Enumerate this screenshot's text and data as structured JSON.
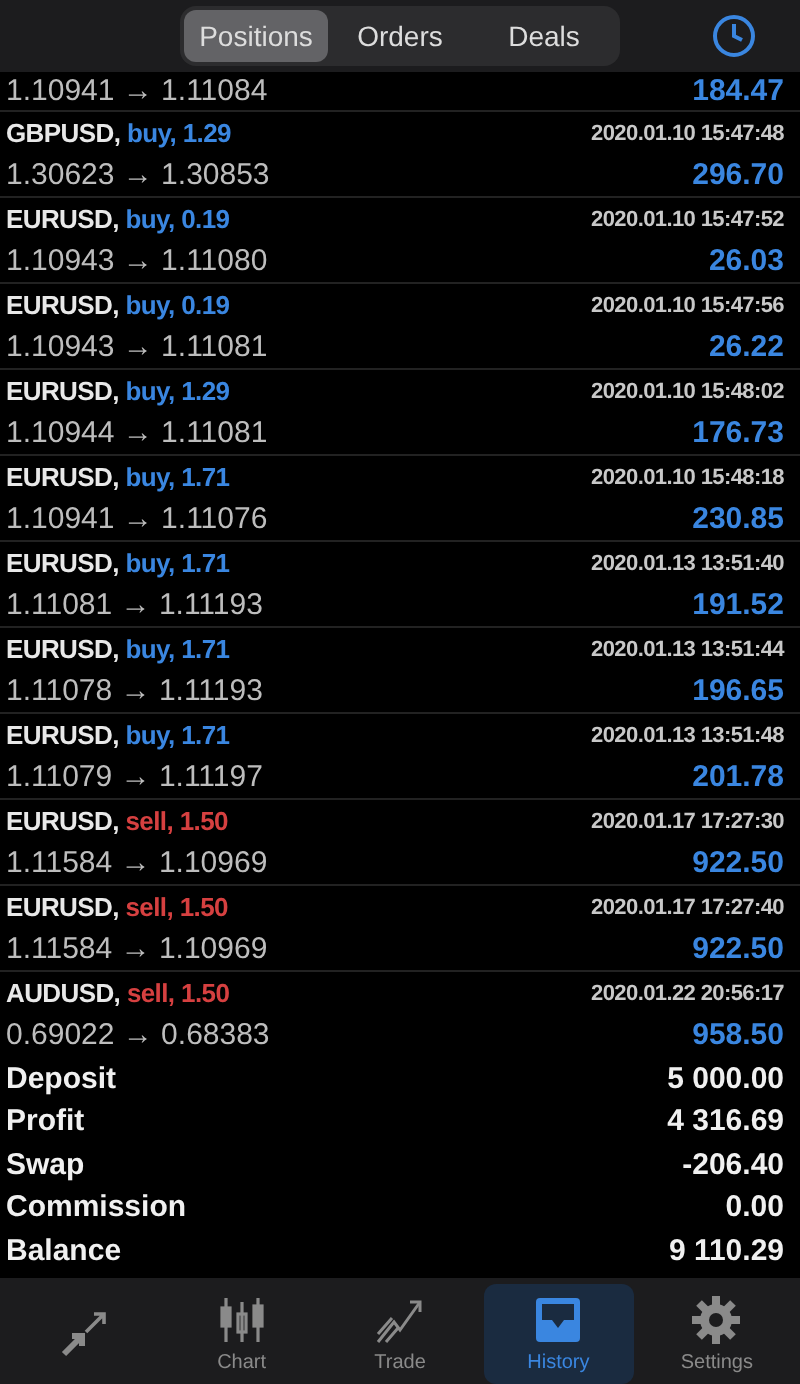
{
  "segments": [
    {
      "label": "Positions",
      "selected": true
    },
    {
      "label": "Orders",
      "selected": false
    },
    {
      "label": "Deals",
      "selected": false
    }
  ],
  "deals": [
    {
      "prices": "1.10941 → 1.11084",
      "profit": "184.47"
    },
    {
      "symbol": "GBPUSD,",
      "kind": "buy",
      "order": "buy, 1.29",
      "time": "2020.01.10 15:47:48",
      "prices": "1.30623 → 1.30853",
      "profit": "296.70"
    },
    {
      "symbol": "EURUSD,",
      "kind": "buy",
      "order": "buy, 0.19",
      "time": "2020.01.10 15:47:52",
      "prices": "1.10943 → 1.11080",
      "profit": "26.03"
    },
    {
      "symbol": "EURUSD,",
      "kind": "buy",
      "order": "buy, 0.19",
      "time": "2020.01.10 15:47:56",
      "prices": "1.10943 → 1.11081",
      "profit": "26.22"
    },
    {
      "symbol": "EURUSD,",
      "kind": "buy",
      "order": "buy, 1.29",
      "time": "2020.01.10 15:48:02",
      "prices": "1.10944 → 1.11081",
      "profit": "176.73"
    },
    {
      "symbol": "EURUSD,",
      "kind": "buy",
      "order": "buy, 1.71",
      "time": "2020.01.10 15:48:18",
      "prices": "1.10941 → 1.11076",
      "profit": "230.85"
    },
    {
      "symbol": "EURUSD,",
      "kind": "buy",
      "order": "buy, 1.71",
      "time": "2020.01.13 13:51:40",
      "prices": "1.11081 → 1.11193",
      "profit": "191.52"
    },
    {
      "symbol": "EURUSD,",
      "kind": "buy",
      "order": "buy, 1.71",
      "time": "2020.01.13 13:51:44",
      "prices": "1.11078 → 1.11193",
      "profit": "196.65"
    },
    {
      "symbol": "EURUSD,",
      "kind": "buy",
      "order": "buy, 1.71",
      "time": "2020.01.13 13:51:48",
      "prices": "1.11079 → 1.11197",
      "profit": "201.78"
    },
    {
      "symbol": "EURUSD,",
      "kind": "sell",
      "order": "sell, 1.50",
      "time": "2020.01.17 17:27:30",
      "prices": "1.11584 → 1.10969",
      "profit": "922.50"
    },
    {
      "symbol": "EURUSD,",
      "kind": "sell",
      "order": "sell, 1.50",
      "time": "2020.01.17 17:27:40",
      "prices": "1.11584 → 1.10969",
      "profit": "922.50"
    },
    {
      "symbol": "AUDUSD,",
      "kind": "sell",
      "order": "sell, 1.50",
      "time": "2020.01.22 20:56:17",
      "prices": "0.69022 → 0.68383",
      "profit": "958.50"
    }
  ],
  "summary": [
    {
      "label": "Deposit",
      "value": "5 000.00"
    },
    {
      "label": "Profit",
      "value": "4 316.69"
    },
    {
      "label": "Swap",
      "value": "-206.40"
    },
    {
      "label": "Commission",
      "value": "0.00"
    },
    {
      "label": "Balance",
      "value": "9 110.29"
    }
  ],
  "tab_bar": [
    {
      "kind": "quotes",
      "selected": false
    },
    {
      "kind": "chart",
      "label": "Chart",
      "selected": false
    },
    {
      "kind": "trade",
      "label": "Trade",
      "selected": false
    },
    {
      "kind": "history",
      "label": "History",
      "selected": true
    },
    {
      "kind": "settings",
      "label": "Settings",
      "selected": false
    }
  ]
}
